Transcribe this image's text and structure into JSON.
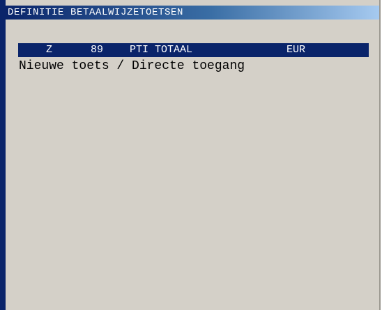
{
  "window": {
    "title": "DEFINITIE BETAALWIJZETOETSEN"
  },
  "list": {
    "selected_row": {
      "code": "Z",
      "number": "89",
      "description": "PTI TOTAAL",
      "currency": "EUR"
    },
    "new_key_label": "Nieuwe toets / Directe toegang"
  },
  "colors": {
    "background": "#d4d0c8",
    "title_gradient_start": "#0a246a",
    "title_gradient_end": "#a6caf0",
    "selection": "#0a246a",
    "text": "#000000",
    "selected_text": "#ffffff"
  }
}
